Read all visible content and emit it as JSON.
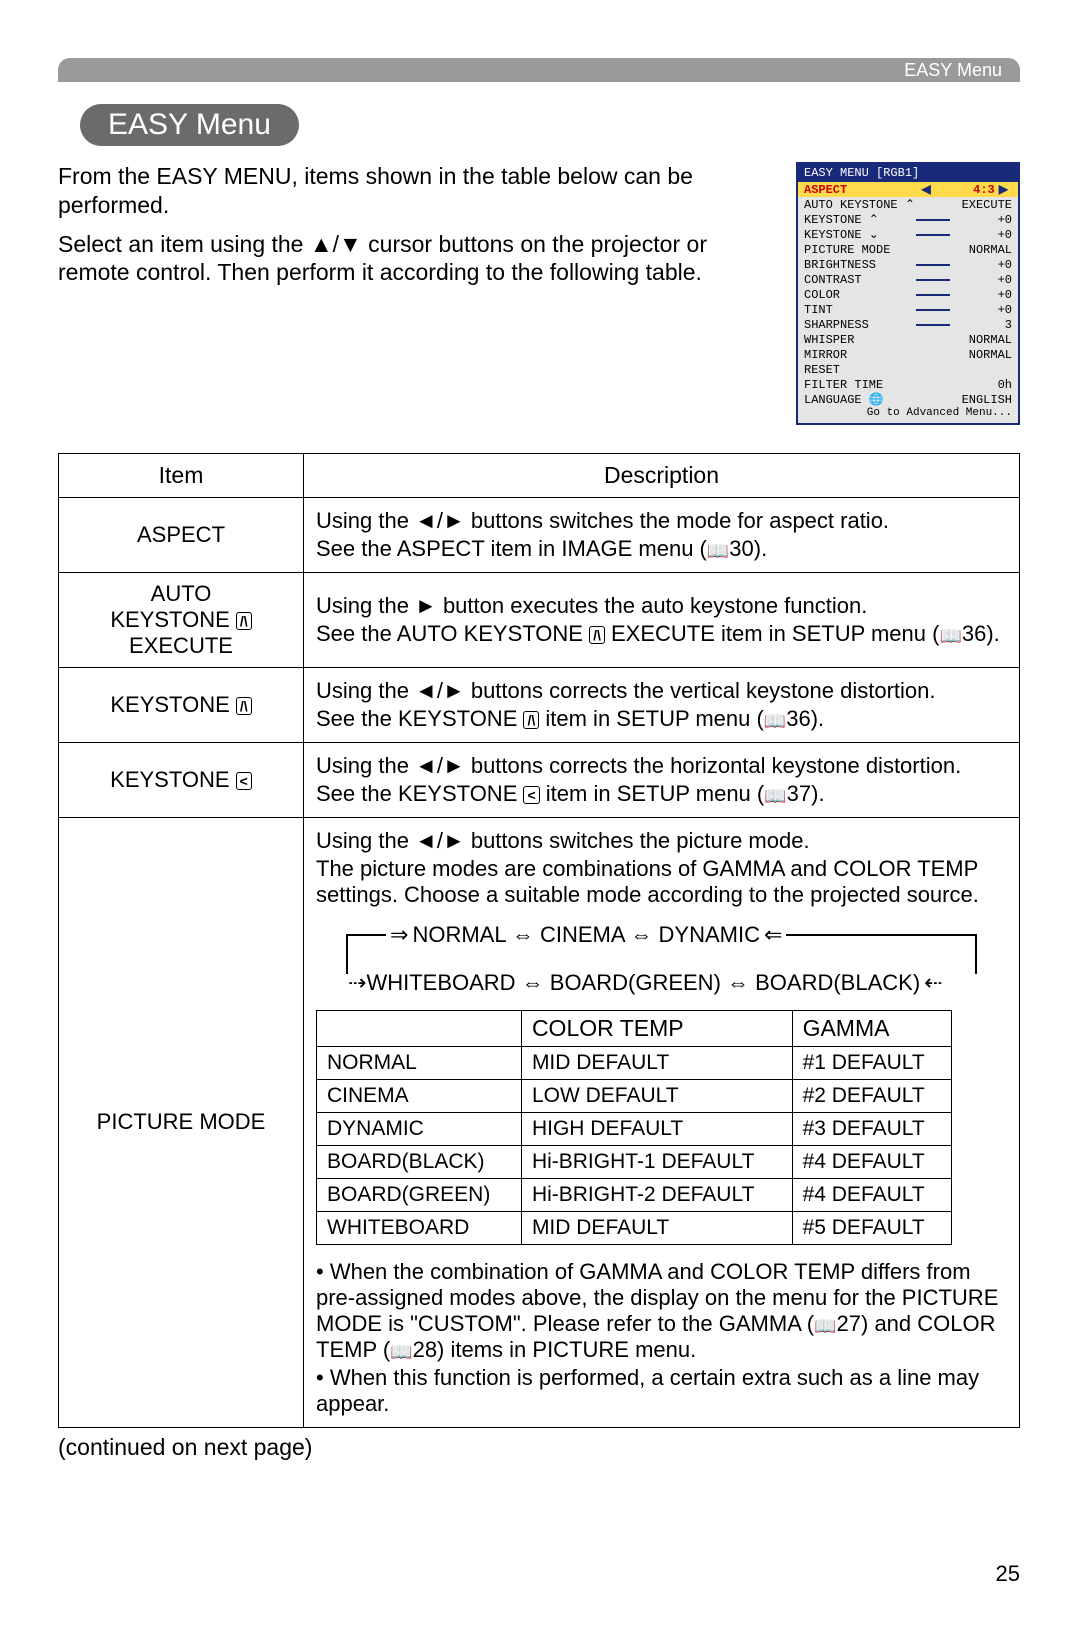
{
  "header_tab": "EASY Menu",
  "section_title": "EASY Menu",
  "intro": {
    "p1": "From the EASY MENU, items shown in the table below can be performed.",
    "p2_a": "Select an item using the ",
    "p2_arrows": "▲/▼",
    "p2_b": " cursor buttons on the projector or remote control. Then perform it according to the following table."
  },
  "osd": {
    "title": "EASY MENU [RGB1]",
    "rows": [
      {
        "label": "ASPECT",
        "left": "◀",
        "val": "4:3",
        "right": "▶",
        "sel": true
      },
      {
        "label": "AUTO KEYSTONE",
        "icon": "⌃",
        "val": "EXECUTE"
      },
      {
        "label": "KEYSTONE",
        "icon": "⌃",
        "bar": true,
        "val": "+0"
      },
      {
        "label": "KEYSTONE",
        "icon": "⌄",
        "bar": true,
        "val": "+0"
      },
      {
        "label": "PICTURE MODE",
        "val": "NORMAL"
      },
      {
        "label": "BRIGHTNESS",
        "bar": true,
        "val": "+0"
      },
      {
        "label": "CONTRAST",
        "bar": true,
        "val": "+0"
      },
      {
        "label": "COLOR",
        "bar": true,
        "val": "+0"
      },
      {
        "label": "TINT",
        "bar": true,
        "val": "+0"
      },
      {
        "label": "SHARPNESS",
        "bar": true,
        "val": "3"
      },
      {
        "label": "WHISPER",
        "val": "NORMAL"
      },
      {
        "label": "MIRROR",
        "val": "NORMAL"
      },
      {
        "label": "RESET",
        "val": ""
      },
      {
        "label": "FILTER TIME",
        "val": "0h"
      },
      {
        "label": "LANGUAGE",
        "icon": "🌐",
        "val": "ENGLISH"
      }
    ],
    "footer": "Go to Advanced Menu..."
  },
  "table": {
    "head_item": "Item",
    "head_desc": "Description",
    "rows": [
      {
        "item": "ASPECT",
        "desc_lines": [
          "Using the ◄/► buttons switches the mode for aspect ratio.",
          "See the ASPECT item in IMAGE menu (📖30)."
        ]
      },
      {
        "item_lines": [
          "AUTO",
          "KEYSTONE ⌃",
          "EXECUTE"
        ],
        "icon_after_line": 1,
        "desc_lines": [
          "Using the ► button executes the auto keystone function.",
          "See the AUTO KEYSTONE ⌃ EXECUTE item in SETUP menu (📖36)."
        ]
      },
      {
        "item": "KEYSTONE ⌃",
        "desc_lines": [
          "Using the ◄/► buttons corrects the vertical keystone distortion.",
          "See the KEYSTONE ⌃ item in SETUP menu (📖36)."
        ]
      },
      {
        "item": "KEYSTONE ⌄",
        "desc_lines": [
          "Using the ◄/► buttons corrects the horizontal keystone distortion.",
          "See the KEYSTONE ⌄ item in SETUP menu (📖37)."
        ]
      }
    ],
    "picture_mode": {
      "item": "PICTURE MODE",
      "intro1": "Using the ◄/► buttons switches the picture mode.",
      "intro2": "The picture modes are combinations of GAMMA and COLOR TEMP settings. Choose a suitable mode according to the projected source.",
      "cycle_top": "NORMAL ⇔ CINEMA ⇔ DYNAMIC",
      "cycle_bottom": "WHITEBOARD ⇔ BOARD(GREEN) ⇔ BOARD(BLACK)",
      "inner_head": [
        "",
        "COLOR TEMP",
        "GAMMA"
      ],
      "inner_rows": [
        [
          "NORMAL",
          "MID DEFAULT",
          "#1 DEFAULT"
        ],
        [
          "CINEMA",
          "LOW DEFAULT",
          "#2 DEFAULT"
        ],
        [
          "DYNAMIC",
          "HIGH DEFAULT",
          "#3 DEFAULT"
        ],
        [
          "BOARD(BLACK)",
          "Hi-BRIGHT-1 DEFAULT",
          "#4 DEFAULT"
        ],
        [
          "BOARD(GREEN)",
          "Hi-BRIGHT-2 DEFAULT",
          "#4 DEFAULT"
        ],
        [
          "WHITEBOARD",
          "MID DEFAULT",
          "#5 DEFAULT"
        ]
      ],
      "note1": "• When the combination of GAMMA and COLOR TEMP differs from pre-assigned modes above, the display on the menu for the PICTURE MODE is \"CUSTOM\". Please refer to the GAMMA (📖27) and COLOR TEMP (📖28) items in PICTURE menu.",
      "note2": "• When this function is performed, a certain extra such as a line may appear."
    }
  },
  "continued": "(continued on next page)",
  "page_number": "25"
}
